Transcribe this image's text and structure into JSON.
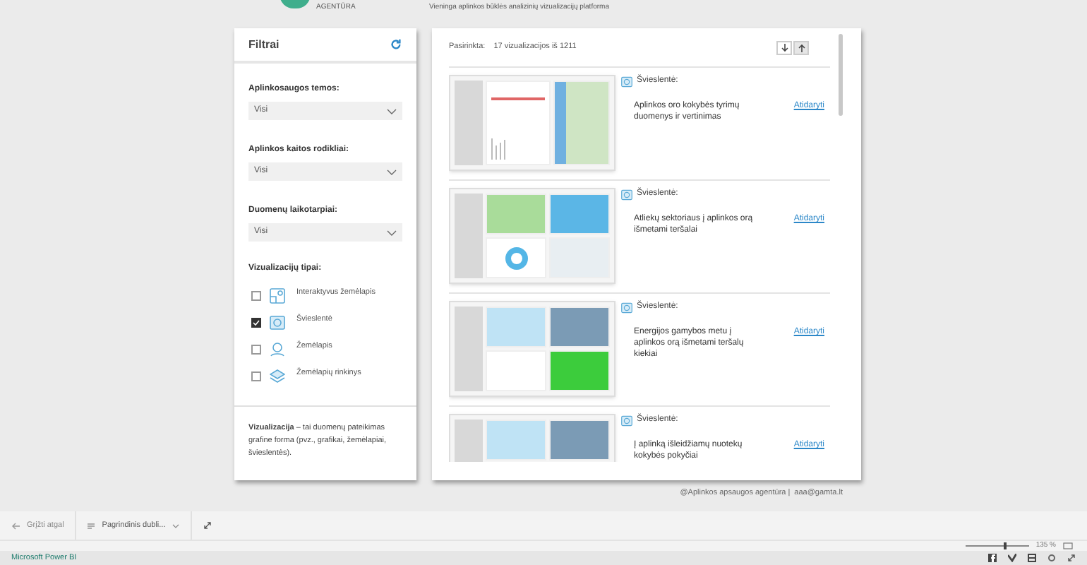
{
  "header": {
    "agency": "AGENTŪRA",
    "subtitle": "Vieninga aplinkos būklės analizinių vizualizacijų platforma"
  },
  "filters": {
    "title": "Filtrai",
    "dropdowns": [
      {
        "label": "Aplinkosaugos temos:",
        "value": "Visi"
      },
      {
        "label": "Aplinkos kaitos rodikliai:",
        "value": "Visi"
      },
      {
        "label": "Duomenų laikotarpiai:",
        "value": "Visi"
      }
    ],
    "types_label": "Vizualizacijų tipai:",
    "types": [
      {
        "label": "Interaktyvus žemėlapis",
        "checked": false,
        "kind": "interactive-map"
      },
      {
        "label": "Švieslentė",
        "checked": true,
        "kind": "dashboard"
      },
      {
        "label": "Žemėlapis",
        "checked": false,
        "kind": "map"
      },
      {
        "label": "Žemėlapių rinkinys",
        "checked": false,
        "kind": "map-set"
      }
    ],
    "note": "**Vizualizacija** – tai duomenų pateikimas grafine forma (pvz., grafikai, žemėlapiai, švieslentės)."
  },
  "results": {
    "summary_label": "Pasirinkta:",
    "summary": "17 vizualizacijos iš 1211",
    "items": [
      {
        "type": "Švieslentė:",
        "title": "Aplinkos oro kokybės tyrimų duomenys ir vertinimas",
        "link": "Atidaryti",
        "kind": "map"
      },
      {
        "type": "Švieslentė:",
        "title": "Atliekų sektoriaus į aplinkos orą išmetami teršalai",
        "link": "Atidaryti",
        "kind": "donut"
      },
      {
        "type": "Švieslentė:",
        "title": "Energijos gamybos metu į aplinkos orą išmetami teršalų kiekiai",
        "link": "Atidaryti",
        "kind": "bars"
      },
      {
        "type": "Švieslentė:",
        "title": "Į aplinką išleidžiamų nuotekų kokybės pokyčiai",
        "link": "Atidaryti",
        "kind": "bars"
      }
    ]
  },
  "footer": {
    "credit": "@Aplinkos apsaugos agentūra |",
    "email": "aaa@gamta.lt"
  },
  "toolbar": {
    "back": "Grįžti atgal",
    "page": "Pagrindinis dubli..."
  },
  "zoom": {
    "level": 0.6,
    "reading": "135 %"
  },
  "brand": "Microsoft Power BI"
}
